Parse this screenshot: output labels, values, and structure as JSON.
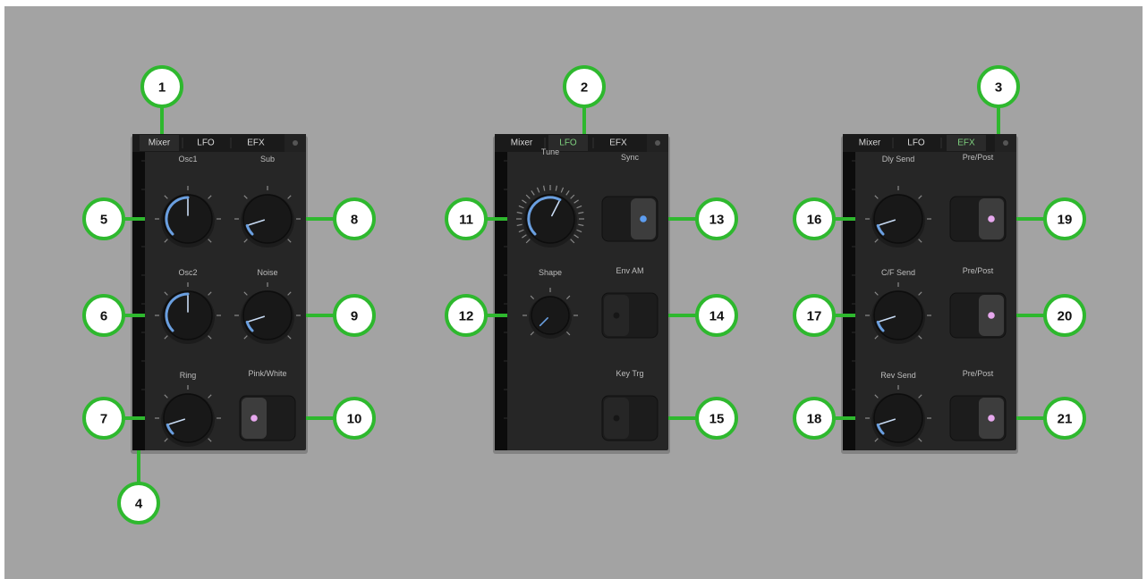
{
  "tabs": [
    "Mixer",
    "LFO",
    "EFX"
  ],
  "colors": {
    "background": "#a3a3a3",
    "panel": "#262626",
    "knob": "#181818",
    "knob_arc": "#6a9fe0",
    "active_tab": "#7ed07e",
    "callout_fill": "#ffffff",
    "callout_ring": "#2eb82e",
    "toggle_dot_pink": "#e7a8ee",
    "toggle_dot_blue": "#5d9df0"
  },
  "panels": [
    {
      "id": "mixer",
      "active_tab": "Mixer",
      "callout": "1",
      "rows": [
        {
          "knob": {
            "label": "Osc1",
            "value": 0.5,
            "callout": "5"
          },
          "right": {
            "kind": "knob",
            "label": "Sub",
            "value": 0.1,
            "callout": "8"
          }
        },
        {
          "knob": {
            "label": "Osc2",
            "value": 0.5,
            "callout": "6"
          },
          "right": {
            "kind": "knob",
            "label": "Noise",
            "value": 0.1,
            "callout": "9"
          }
        },
        {
          "knob": {
            "label": "Ring",
            "value": 0.1,
            "callout": "7"
          },
          "right": {
            "kind": "toggle",
            "label": "Pink/White",
            "state": "left",
            "dot": "toggle_dot_pink",
            "callout": "10"
          }
        }
      ],
      "meter_callout": "4"
    },
    {
      "id": "lfo",
      "active_tab": "LFO",
      "callout": "2",
      "rows": [
        {
          "knob": {
            "label": "Tune",
            "value": 0.6,
            "style": "ticks-ring",
            "callout": "11"
          },
          "right": {
            "kind": "toggle",
            "label": "Sync",
            "state": "right",
            "dot": "toggle_dot_blue",
            "callout": "13"
          }
        },
        {
          "knob": {
            "label": "Shape",
            "value": 0.0,
            "style": "small",
            "callout": "12"
          },
          "right": {
            "kind": "toggle",
            "label": "Env AM",
            "state": "off",
            "callout": "14"
          }
        },
        {
          "right": {
            "kind": "toggle",
            "label": "Key Trg",
            "state": "off",
            "callout": "15"
          }
        }
      ]
    },
    {
      "id": "efx",
      "active_tab": "EFX",
      "callout": "3",
      "rows": [
        {
          "knob": {
            "label": "Dly Send",
            "value": 0.1,
            "callout": "16"
          },
          "right": {
            "kind": "toggle",
            "label": "Pre/Post",
            "state": "right",
            "dot": "toggle_dot_pink",
            "callout": "19"
          }
        },
        {
          "knob": {
            "label": "C/F Send",
            "value": 0.1,
            "callout": "17"
          },
          "right": {
            "kind": "toggle",
            "label": "Pre/Post",
            "state": "right",
            "dot": "toggle_dot_pink",
            "callout": "20"
          }
        },
        {
          "knob": {
            "label": "Rev Send",
            "value": 0.1,
            "callout": "18"
          },
          "right": {
            "kind": "toggle",
            "label": "Pre/Post",
            "state": "right",
            "dot": "toggle_dot_pink",
            "callout": "21"
          }
        }
      ]
    }
  ]
}
